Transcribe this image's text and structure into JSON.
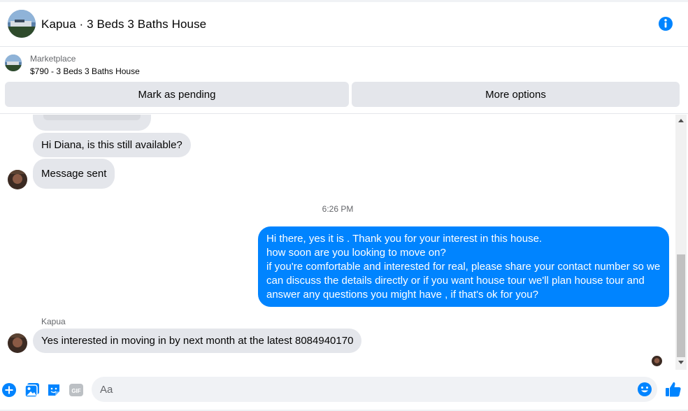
{
  "header": {
    "title": "Kapua · 3 Beds 3 Baths House",
    "info_icon": "info-icon"
  },
  "marketplace": {
    "label": "Marketplace",
    "listing": "$790 - 3 Beds 3 Baths House",
    "mark_pending_label": "Mark as pending",
    "more_options_label": "More options"
  },
  "messages": [
    {
      "direction": "incoming",
      "text": "Hi Diana, is this still available?"
    },
    {
      "direction": "incoming",
      "text": "Message sent"
    },
    {
      "direction": "outgoing",
      "lines": [
        "Hi there, yes it is . Thank you for your interest in this house.",
        "how soon are you looking to move on?",
        "if you're comfortable and interested for real, please share your contact number so we",
        "can discuss the details directly or if you  want house tour we'll plan house tour and",
        "answer any questions you might have , if that's ok for you?"
      ]
    },
    {
      "direction": "incoming",
      "sender": "Kapua",
      "text": "Yes interested in moving in by next month at the latest 8084940170"
    }
  ],
  "timestamp": "6:26 PM",
  "composer": {
    "placeholder": "Aa",
    "icons": [
      "plus-icon",
      "photo-icon",
      "sticker-icon",
      "gif-icon",
      "emoji-icon",
      "thumbs-up-icon"
    ],
    "gif_label": "GIF"
  },
  "colors": {
    "accent": "#0084ff",
    "bubble_in": "#e4e6eb",
    "button_bg": "#e4e6eb",
    "secondary_text": "#65676b"
  }
}
